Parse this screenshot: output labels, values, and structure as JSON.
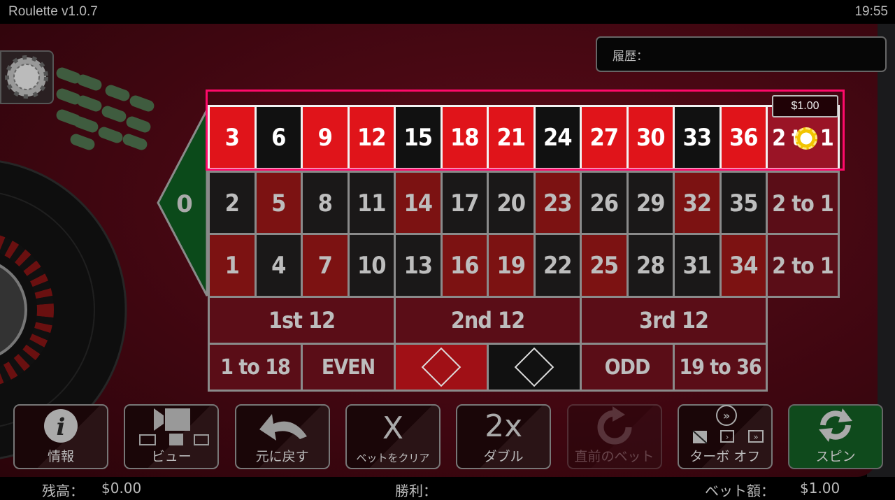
{
  "app": {
    "title": "Roulette v1.0.7",
    "clock": "19:55"
  },
  "history": {
    "label": "履歴："
  },
  "zero": "0",
  "rows": [
    [
      {
        "n": "3",
        "c": "r"
      },
      {
        "n": "6",
        "c": "b"
      },
      {
        "n": "9",
        "c": "r"
      },
      {
        "n": "12",
        "c": "r"
      },
      {
        "n": "15",
        "c": "b"
      },
      {
        "n": "18",
        "c": "r"
      },
      {
        "n": "21",
        "c": "r"
      },
      {
        "n": "24",
        "c": "b"
      },
      {
        "n": "27",
        "c": "r"
      },
      {
        "n": "30",
        "c": "r"
      },
      {
        "n": "33",
        "c": "b"
      },
      {
        "n": "36",
        "c": "r"
      }
    ],
    [
      {
        "n": "2",
        "c": "b"
      },
      {
        "n": "5",
        "c": "r"
      },
      {
        "n": "8",
        "c": "b"
      },
      {
        "n": "11",
        "c": "b"
      },
      {
        "n": "14",
        "c": "r"
      },
      {
        "n": "17",
        "c": "b"
      },
      {
        "n": "20",
        "c": "b"
      },
      {
        "n": "23",
        "c": "r"
      },
      {
        "n": "26",
        "c": "b"
      },
      {
        "n": "29",
        "c": "b"
      },
      {
        "n": "32",
        "c": "r"
      },
      {
        "n": "35",
        "c": "b"
      }
    ],
    [
      {
        "n": "1",
        "c": "r"
      },
      {
        "n": "4",
        "c": "b"
      },
      {
        "n": "7",
        "c": "r"
      },
      {
        "n": "10",
        "c": "b"
      },
      {
        "n": "13",
        "c": "b"
      },
      {
        "n": "16",
        "c": "r"
      },
      {
        "n": "19",
        "c": "r"
      },
      {
        "n": "22",
        "c": "b"
      },
      {
        "n": "25",
        "c": "r"
      },
      {
        "n": "28",
        "c": "b"
      },
      {
        "n": "31",
        "c": "b"
      },
      {
        "n": "34",
        "c": "r"
      }
    ]
  ],
  "column_bets": [
    "2 to 1",
    "2 to 1",
    "2 to 1"
  ],
  "dozens": [
    "1st 12",
    "2nd 12",
    "3rd 12"
  ],
  "outside": {
    "low": "1 to 18",
    "even": "EVEN",
    "odd": "ODD",
    "high": "19 to 36"
  },
  "selected_bet": {
    "row": "top column",
    "amount": "$1.00",
    "chip_color": "#f2c500"
  },
  "colors": {
    "highlight": "#ff0a6a",
    "red": "#e0141a",
    "green": "#0f4a1c"
  },
  "buttons": [
    {
      "id": "info",
      "label": "情報",
      "icon": "info-icon",
      "enabled": true
    },
    {
      "id": "view",
      "label": "ビュー",
      "icon": "camera-view-icon",
      "enabled": true
    },
    {
      "id": "undo",
      "label": "元に戻す",
      "icon": "undo-arrow-icon",
      "enabled": true
    },
    {
      "id": "clear",
      "label": "ベットをクリア",
      "icon": "x-icon",
      "icon_text": "X",
      "enabled": true
    },
    {
      "id": "double",
      "label": "ダブル",
      "icon": "double-icon",
      "icon_text": "2x",
      "enabled": true
    },
    {
      "id": "rebet",
      "label": "直前のベット",
      "icon": "redo-icon",
      "enabled": false
    },
    {
      "id": "turbo",
      "label": "ターボ オフ",
      "icon": "turbo-icon",
      "enabled": true
    },
    {
      "id": "spin",
      "label": "スピン",
      "icon": "spin-icon",
      "enabled": true
    }
  ],
  "footer": {
    "balance_label": "残高：",
    "balance": "$0.00",
    "win_label": "勝利：",
    "bet_label": "ベット額：",
    "bet": "$1.00"
  }
}
